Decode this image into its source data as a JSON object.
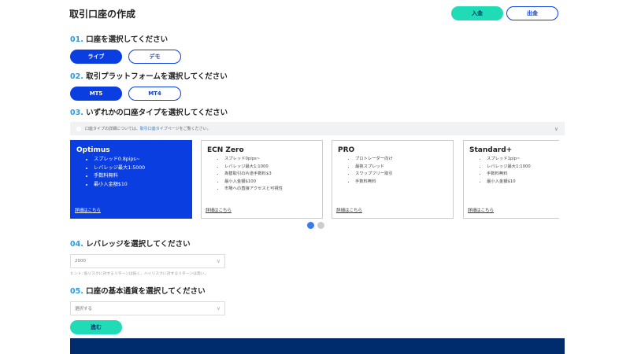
{
  "header": {
    "title": "取引口座の作成",
    "deposit": "入金",
    "withdraw": "出金"
  },
  "step1": {
    "num": "01.",
    "label": "口座を選択してください",
    "options": [
      "ライブ",
      "デモ"
    ],
    "selected": "ライブ"
  },
  "step2": {
    "num": "02.",
    "label": "取引プラットフォームを選択してください",
    "options": [
      "MT5",
      "MT4"
    ],
    "selected": "MT5"
  },
  "step3": {
    "num": "03.",
    "label": "いずれかの口座タイプを選択してください",
    "info_prefix": "口座タイプの詳細については、",
    "info_link": "取引口座タイプ",
    "info_suffix": "ページをご覧ください。",
    "cards": [
      {
        "name": "Optimus",
        "features": [
          "スプレッド0.8pips~",
          "レバレッジ最大1:5000",
          "手数料無料",
          "最小入金額$10"
        ],
        "more": "詳細はこちら"
      },
      {
        "name": "ECN Zero",
        "features": [
          "スプレッド0pips~",
          "レバレッジ最大1:1000",
          "為替取引の片道手数料$3",
          "最小入金額$100",
          "市場への直接アクセスと可視性"
        ],
        "more": "詳細はこちら"
      },
      {
        "name": "PRO",
        "features": [
          "プロトレーダー向け",
          "最狭スプレッド",
          "スワップフリー取引",
          "手数料無料"
        ],
        "more": "詳細はこちら"
      },
      {
        "name": "Standard+",
        "features": [
          "スプレッド1pip~",
          "レバレッジ最大1:1000",
          "手数料無料",
          "最小入金額$10"
        ],
        "more": "詳細はこちら"
      }
    ],
    "selected": "Optimus",
    "page": 1,
    "pages": 2
  },
  "step4": {
    "num": "04.",
    "label": "レバレッジを選択してください",
    "value": "2000",
    "hint": "ヒント: 低リスクに対するリターンは低く、ハイリスクに対するリターンは高い。"
  },
  "step5": {
    "num": "05.",
    "label": "口座の基本通貨を選択してください",
    "placeholder": "選択する"
  },
  "submit": "進む",
  "colors": {
    "primary": "#0a3ee0",
    "accent": "#1fdcb6",
    "footer": "#002b6d"
  }
}
